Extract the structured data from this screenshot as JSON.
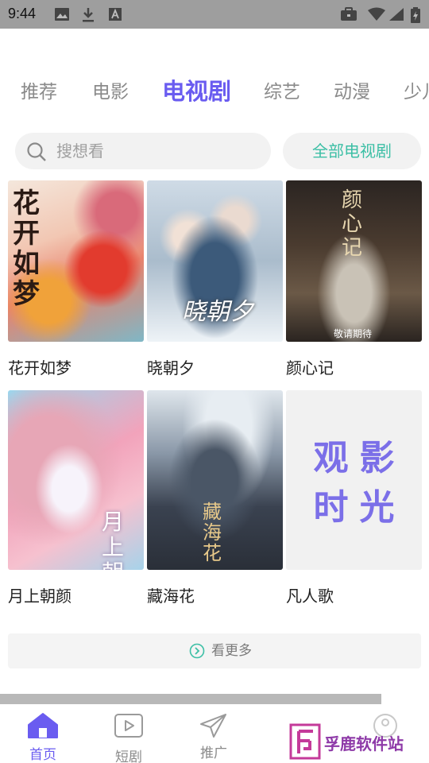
{
  "status_bar": {
    "time": "9:44",
    "left_icons": [
      "image-icon",
      "download-icon",
      "a-box-icon"
    ],
    "right_icons": [
      "briefcase-icon",
      "wifi-icon",
      "signal-icon",
      "battery-icon"
    ]
  },
  "categories": {
    "tabs": [
      "推荐",
      "电影",
      "电视剧",
      "综艺",
      "动漫",
      "少儿"
    ],
    "active_index": 2,
    "active_color": "#6a5cf0"
  },
  "search": {
    "placeholder": "搜想看",
    "all_button_label": "全部电视剧",
    "all_button_color": "#3cbfa5"
  },
  "posters": [
    {
      "title": "花开如梦",
      "art_text": "花开如梦"
    },
    {
      "title": "晓朝夕",
      "art_text": "晓朝夕"
    },
    {
      "title": "颜心记",
      "art_text": "颜心记",
      "art_subtext": "敬请期待"
    },
    {
      "title": "月上朝颜",
      "art_text": "月上朝颜"
    },
    {
      "title": "藏海花",
      "art_text": "藏海花"
    },
    {
      "title": "凡人歌",
      "placeholder_text": "观影时光"
    }
  ],
  "see_more": {
    "label": "看更多"
  },
  "bottom_nav": {
    "items": [
      {
        "label": "首页",
        "icon": "home-icon",
        "active": true
      },
      {
        "label": "短剧",
        "icon": "play-box-icon"
      },
      {
        "label": "推广",
        "icon": "paper-plane-icon"
      },
      {
        "label": "",
        "icon": "tool-icon"
      },
      {
        "label": "",
        "icon": "user-icon"
      }
    ]
  },
  "watermark": {
    "text": "孚鹿软件站",
    "color": "#8e3aa8"
  }
}
